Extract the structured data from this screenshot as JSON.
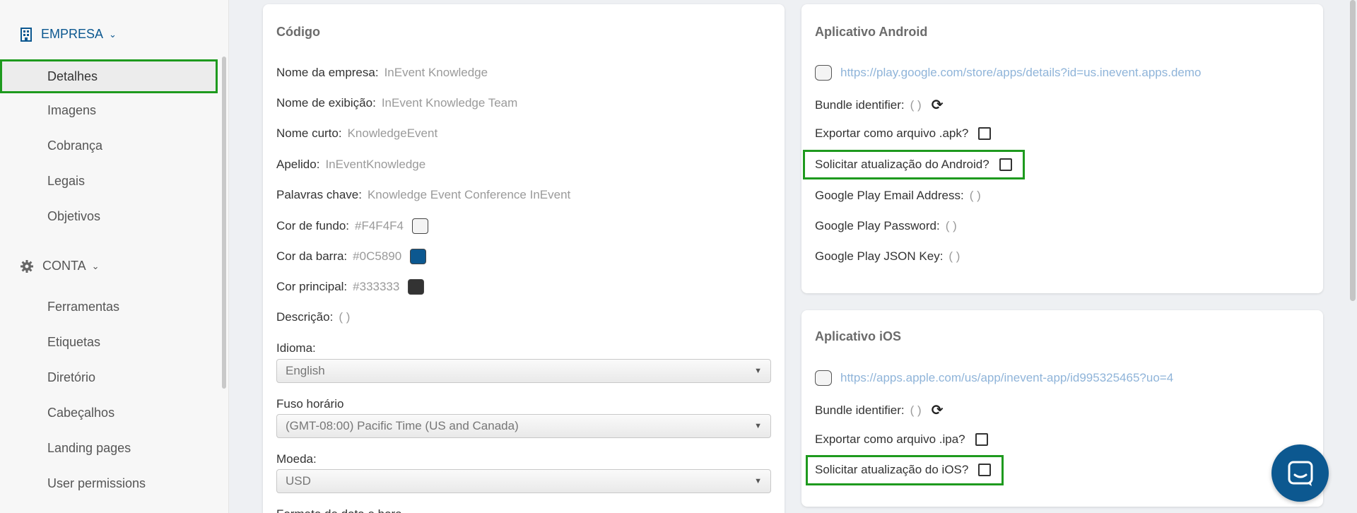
{
  "sidebar": {
    "empresa": {
      "label": "EMPRESA",
      "icon": "building-icon"
    },
    "empresa_items": [
      "Detalhes",
      "Imagens",
      "Cobrança",
      "Legais",
      "Objetivos"
    ],
    "conta": {
      "label": "CONTA",
      "icon": "gear-icon"
    },
    "conta_items": [
      "Ferramentas",
      "Etiquetas",
      "Diretório",
      "Cabeçalhos",
      "Landing pages",
      "User permissions"
    ]
  },
  "left_card": {
    "title": "Código",
    "fields": [
      {
        "label": "Nome da empresa:",
        "value": "InEvent Knowledge"
      },
      {
        "label": "Nome de exibição:",
        "value": "InEvent Knowledge Team"
      },
      {
        "label": "Nome curto:",
        "value": "KnowledgeEvent"
      },
      {
        "label": "Apelido:",
        "value": "InEventKnowledge"
      },
      {
        "label": "Palavras chave:",
        "value": "Knowledge Event Conference InEvent"
      },
      {
        "label": "Cor de fundo:",
        "value": "#F4F4F4",
        "color": "#F4F4F4"
      },
      {
        "label": "Cor da barra:",
        "value": "#0C5890",
        "color": "#0C5890"
      },
      {
        "label": "Cor principal:",
        "value": "#333333",
        "color": "#333333"
      },
      {
        "label": "Descrição:",
        "value": "( )"
      }
    ],
    "idioma": {
      "label": "Idioma:",
      "value": "English"
    },
    "fuso": {
      "label": "Fuso horário",
      "value": "(GMT-08:00) Pacific Time (US and Canada)"
    },
    "moeda": {
      "label": "Moeda:",
      "value": "USD"
    },
    "cut_label": "Formato de data e hora"
  },
  "android": {
    "title": "Aplicativo Android",
    "link": "https://play.google.com/store/apps/details?id=us.inevent.apps.demo",
    "bundle_label": "Bundle identifier:",
    "bundle_value": "( )",
    "export_label": "Exportar como arquivo .apk?",
    "update_label": "Solicitar atualização do Android?",
    "email_label": "Google Play Email Address:",
    "email_value": "( )",
    "password_label": "Google Play Password:",
    "password_value": "( )",
    "json_label": "Google Play JSON Key:",
    "json_value": "( )"
  },
  "ios": {
    "title": "Aplicativo iOS",
    "link": "https://apps.apple.com/us/app/inevent-app/id995325465?uo=4",
    "bundle_label": "Bundle identifier:",
    "bundle_value": "( )",
    "export_label": "Exportar como arquivo .ipa?",
    "update_label": "Solicitar atualização do iOS?"
  },
  "colors": {
    "accent": "#0C5890",
    "highlight": "#1e9a1e"
  }
}
